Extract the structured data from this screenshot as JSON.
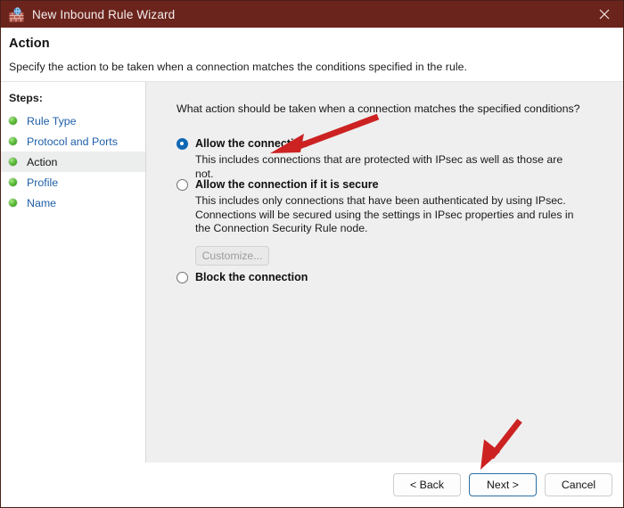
{
  "window": {
    "title": "New Inbound Rule Wizard",
    "app_icon": "firewall-globe-icon",
    "close_label": "×",
    "titlebar_color": "#6b241c"
  },
  "header": {
    "title": "Action",
    "subtitle": "Specify the action to be taken when a connection matches the conditions specified in the rule."
  },
  "sidebar": {
    "heading": "Steps:",
    "items": [
      {
        "label": "Rule Type",
        "current": false
      },
      {
        "label": "Protocol and Ports",
        "current": false
      },
      {
        "label": "Action",
        "current": true
      },
      {
        "label": "Profile",
        "current": false
      },
      {
        "label": "Name",
        "current": false
      }
    ]
  },
  "main": {
    "question": "What action should be taken when a connection matches the specified conditions?",
    "options": [
      {
        "id": "allow",
        "title": "Allow the connection",
        "selected": true,
        "description": "This includes connections that are protected with IPsec as well as those are not."
      },
      {
        "id": "allow-secure",
        "title": "Allow the connection if it is secure",
        "selected": false,
        "description": "This includes only connections that have been authenticated by using IPsec.  Connections will be secured using the settings in IPsec properties and rules in the Connection Security Rule node.",
        "customize_label": "Customize...",
        "customize_disabled": true
      },
      {
        "id": "block",
        "title": "Block the connection",
        "selected": false,
        "description": ""
      }
    ]
  },
  "footer": {
    "back_label": "< Back",
    "next_label": "Next >",
    "cancel_label": "Cancel",
    "default_button": "Next >"
  },
  "annotations": {
    "arrow_color": "#cc2222",
    "arrows": [
      {
        "name": "arrow-pointing-allow-the-connection",
        "points_to": "Allow the connection"
      },
      {
        "name": "arrow-pointing-next-button",
        "points_to": "Next >"
      }
    ]
  }
}
